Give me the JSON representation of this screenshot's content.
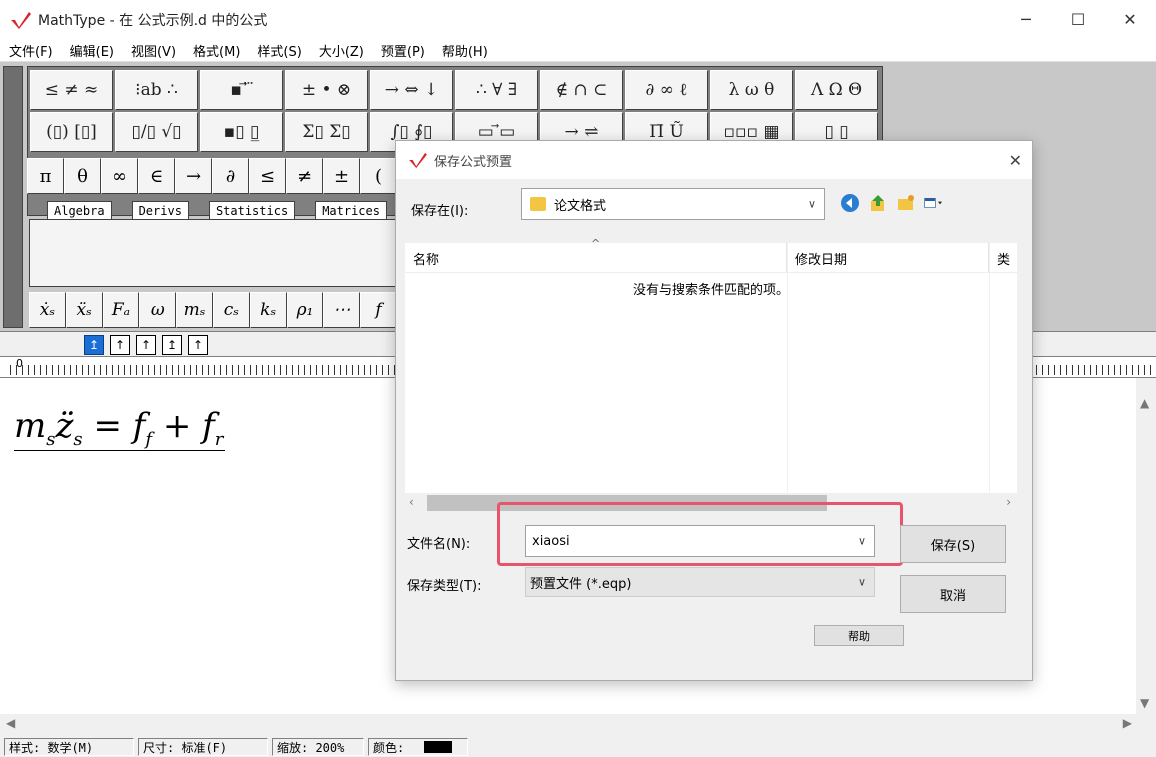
{
  "app": {
    "title": "MathType - 在 公式示例.d 中的公式",
    "minimize": "─",
    "maximize": "☐",
    "close": "✕"
  },
  "menu": [
    "文件(F)",
    "编辑(E)",
    "视图(V)",
    "格式(M)",
    "样式(S)",
    "大小(Z)",
    "预置(P)",
    "帮助(H)"
  ],
  "palettes": {
    "row1": [
      "≤ ≠ ≈",
      "⁝ab ∴",
      "▪ ⃗ ⃛",
      "± • ⊗",
      "→ ⇔ ↓",
      "∴ ∀ ∃",
      "∉ ∩ ⊂",
      "∂ ∞ ℓ",
      "λ ω θ",
      "Λ Ω Θ"
    ],
    "row2": [
      "(▯) [▯]",
      "▯/▯ √▯",
      "▪▯ ▯̲",
      "Σ▯ Σ▯",
      "∫▯ ∮▯",
      "▭ ⃗▭",
      "→ ⇌",
      "Π̄ Ũ",
      "▫▫▫ ▦",
      "▯ ▯"
    ]
  },
  "symbols": [
    "π",
    "θ",
    "∞",
    "∈",
    "→",
    "∂",
    "≤",
    "≠",
    "±",
    "("
  ],
  "tabs": [
    "Algebra",
    "Derivs",
    "Statistics",
    "Matrices"
  ],
  "templates": [
    "ẋₛ",
    "ẍₛ",
    "Fₐ",
    "ω",
    "mₛ",
    "cₛ",
    "kₛ",
    "ρ₁",
    "⋯",
    "f"
  ],
  "nudges": [
    "↥",
    "↑",
    "↑",
    "↥",
    "↑"
  ],
  "ruler_zero": "0",
  "equation": {
    "m": "m",
    "s1": "s",
    "z": "z̈",
    "s2": "s",
    "eq": " = ",
    "f1": "f",
    "fsub": "f",
    "plus": " + ",
    "f2": "f",
    "rsub": "r"
  },
  "status": {
    "style": "样式: 数学(M)",
    "size": "尺寸: 标准(F)",
    "zoom": "缩放: 200%",
    "color": "颜色:"
  },
  "dialog": {
    "title": "保存公式预置",
    "save_in_label": "保存在(I):",
    "save_in_value": "论文格式",
    "columns": [
      "名称",
      "修改日期",
      "类"
    ],
    "empty_message": "没有与搜索条件匹配的项。",
    "filename_label": "文件名(N):",
    "filename_value": "xiaosi",
    "filetype_label": "保存类型(T):",
    "filetype_value": "预置文件 (*.eqp)",
    "save_button": "保存(S)",
    "cancel_button": "取消",
    "help_button": "帮助"
  },
  "colors": {
    "highlight": "#e8556a",
    "accent": "#1a6fd6",
    "logo": "#d9252a"
  }
}
